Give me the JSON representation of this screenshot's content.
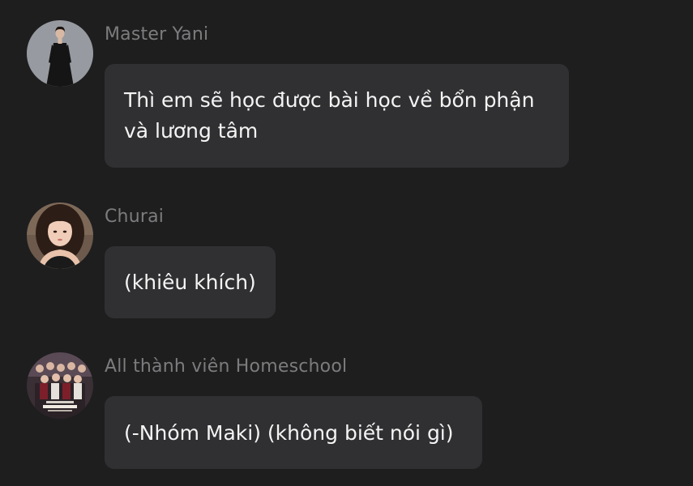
{
  "messages": [
    {
      "sender": "Master Yani",
      "text_lines": [
        "Thì em sẽ học được bài học về bổn phận",
        "và lương tâm"
      ],
      "avatar_icon": "avatar-woman-black-dress"
    },
    {
      "sender": "Churai",
      "text_lines": [
        "(khiêu khích)"
      ],
      "avatar_icon": "avatar-girl-portrait"
    },
    {
      "sender": "All thành viên Homeschool",
      "text_lines": [
        "(-Nhóm Maki) (không biết nói gì)"
      ],
      "avatar_icon": "avatar-group-poster"
    }
  ],
  "colors": {
    "background": "#1e1e1f",
    "bubble": "#303032",
    "sender": "#7c7c7e",
    "text": "#f4f4f4"
  }
}
